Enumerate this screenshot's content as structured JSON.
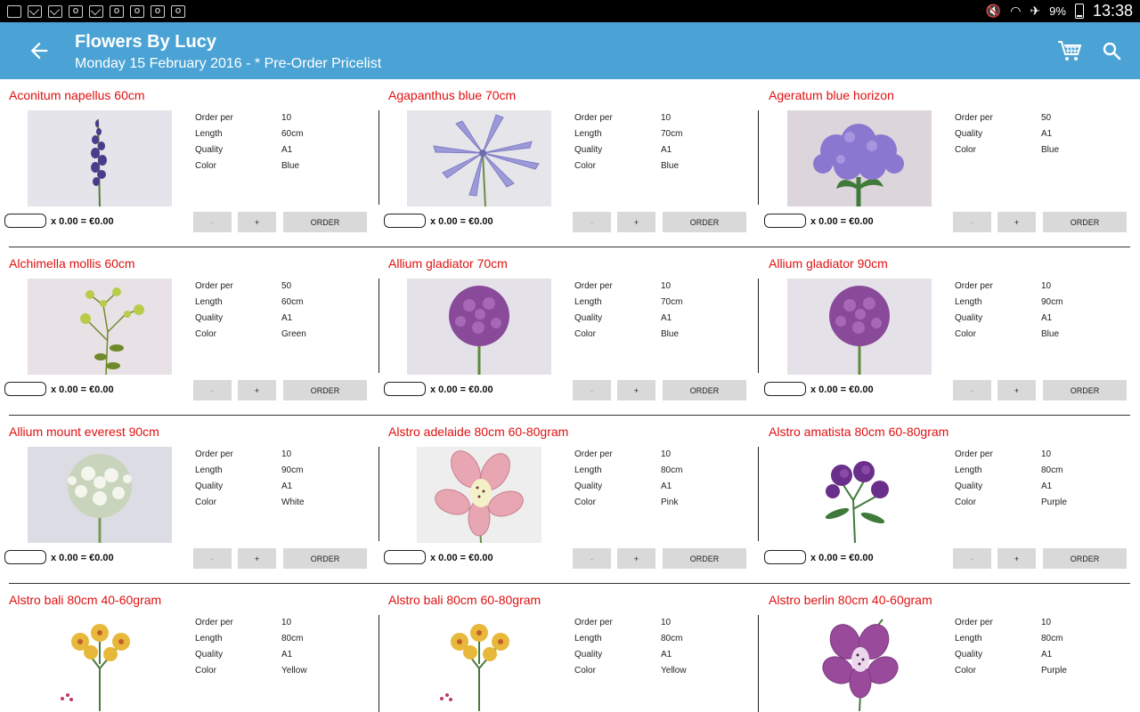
{
  "status_bar": {
    "time": "13:38",
    "battery": "9%"
  },
  "header": {
    "title": "Flowers By Lucy",
    "subtitle": "Monday 15 February 2016 - * Pre-Order Pricelist"
  },
  "labels": {
    "order_per": "Order per",
    "length": "Length",
    "quality": "Quality",
    "color": "Color",
    "minus": "-",
    "plus": "+",
    "order": "ORDER"
  },
  "products": [
    {
      "name": "Aconitum napellus 60cm",
      "order_per": "10",
      "length": "60cm",
      "quality": "A1",
      "color": "Blue",
      "total": "x 0.00 = €0.00"
    },
    {
      "name": "Agapanthus blue 70cm",
      "order_per": "10",
      "length": "70cm",
      "quality": "A1",
      "color": "Blue",
      "total": "x 0.00 = €0.00"
    },
    {
      "name": "Ageratum blue horizon",
      "order_per": "50",
      "length": "",
      "quality": "A1",
      "color": "Blue",
      "total": "x 0.00 = €0.00"
    },
    {
      "name": "Alchimella mollis 60cm",
      "order_per": "50",
      "length": "60cm",
      "quality": "A1",
      "color": "Green",
      "total": "x 0.00 = €0.00"
    },
    {
      "name": "Allium gladiator 70cm",
      "order_per": "10",
      "length": "70cm",
      "quality": "A1",
      "color": "Blue",
      "total": "x 0.00 = €0.00"
    },
    {
      "name": "Allium gladiator 90cm",
      "order_per": "10",
      "length": "90cm",
      "quality": "A1",
      "color": "Blue",
      "total": "x 0.00 = €0.00"
    },
    {
      "name": "Allium mount everest 90cm",
      "order_per": "10",
      "length": "90cm",
      "quality": "A1",
      "color": "White",
      "total": "x 0.00 = €0.00"
    },
    {
      "name": "Alstro adelaide 80cm 60-80gram",
      "order_per": "10",
      "length": "80cm",
      "quality": "A1",
      "color": "Pink",
      "total": "x 0.00 = €0.00"
    },
    {
      "name": "Alstro amatista 80cm 60-80gram",
      "order_per": "10",
      "length": "80cm",
      "quality": "A1",
      "color": "Purple",
      "total": "x 0.00 = €0.00"
    },
    {
      "name": "Alstro bali 80cm 40-60gram",
      "order_per": "10",
      "length": "80cm",
      "quality": "A1",
      "color": "Yellow",
      "total": ""
    },
    {
      "name": "Alstro bali 80cm 60-80gram",
      "order_per": "10",
      "length": "80cm",
      "quality": "A1",
      "color": "Yellow",
      "total": ""
    },
    {
      "name": "Alstro berlin 80cm 40-60gram",
      "order_per": "10",
      "length": "80cm",
      "quality": "A1",
      "color": "Purple",
      "total": ""
    }
  ],
  "colors": {
    "appbar": "#4aa3d4",
    "product_title": "#e01010",
    "button": "#d9d9d9"
  }
}
